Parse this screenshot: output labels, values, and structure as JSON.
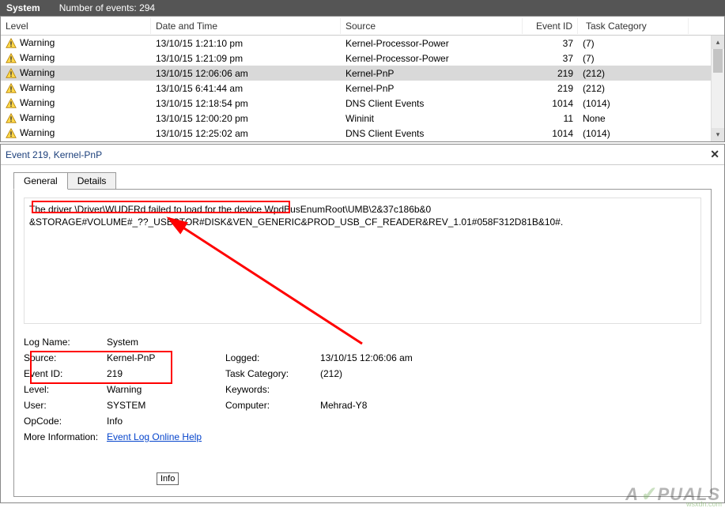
{
  "topbar": {
    "title": "System",
    "count_label": "Number of events: 294"
  },
  "columns": {
    "level": "Level",
    "date": "Date and Time",
    "source": "Source",
    "eventid": "Event ID",
    "task": "Task Category"
  },
  "rows": [
    {
      "level": "Warning",
      "date": "13/10/15 1:21:10 pm",
      "source": "Kernel-Processor-Power",
      "eventid": "37",
      "task": "(7)",
      "selected": false
    },
    {
      "level": "Warning",
      "date": "13/10/15 1:21:09 pm",
      "source": "Kernel-Processor-Power",
      "eventid": "37",
      "task": "(7)",
      "selected": false
    },
    {
      "level": "Warning",
      "date": "13/10/15 12:06:06 am",
      "source": "Kernel-PnP",
      "eventid": "219",
      "task": "(212)",
      "selected": true
    },
    {
      "level": "Warning",
      "date": "13/10/15 6:41:44 am",
      "source": "Kernel-PnP",
      "eventid": "219",
      "task": "(212)",
      "selected": false
    },
    {
      "level": "Warning",
      "date": "13/10/15 12:18:54 pm",
      "source": "DNS Client Events",
      "eventid": "1014",
      "task": "(1014)",
      "selected": false
    },
    {
      "level": "Warning",
      "date": "13/10/15 12:00:20 pm",
      "source": "Wininit",
      "eventid": "11",
      "task": "None",
      "selected": false
    },
    {
      "level": "Warning",
      "date": "13/10/15 12:25:02 am",
      "source": "DNS Client Events",
      "eventid": "1014",
      "task": "(1014)",
      "selected": false
    }
  ],
  "detail": {
    "header": "Event 219, Kernel-PnP",
    "tabs": {
      "general": "General",
      "details": "Details"
    },
    "message_line1": "The driver \\Driver\\WUDFRd failed to load for the device WpdBusEnumRoot\\UMB\\2&37c186b&0",
    "message_line2": "&STORAGE#VOLUME#_??_USBSTOR#DISK&VEN_GENERIC&PROD_USB_CF_READER&REV_1.01#058F312D81B&10#.",
    "props": {
      "logname_l": "Log Name:",
      "logname_v": "System",
      "source_l": "Source:",
      "source_v": "Kernel-PnP",
      "logged_l": "Logged:",
      "logged_v": "13/10/15 12:06:06 am",
      "eventid_l": "Event ID:",
      "eventid_v": "219",
      "taskcat_l": "Task Category:",
      "taskcat_v": "(212)",
      "level_l": "Level:",
      "level_v": "Warning",
      "keywords_l": "Keywords:",
      "keywords_v": "",
      "user_l": "User:",
      "user_v": "SYSTEM",
      "computer_l": "Computer:",
      "computer_v": "Mehrad-Y8",
      "opcode_l": "OpCode:",
      "opcode_v": "Info",
      "moreinfo_l": "More Information:",
      "moreinfo_link": "Event Log Online Help"
    },
    "tooltip": "Info"
  },
  "watermark": {
    "text": "A  PUALS",
    "src": "wsxdn.com"
  }
}
